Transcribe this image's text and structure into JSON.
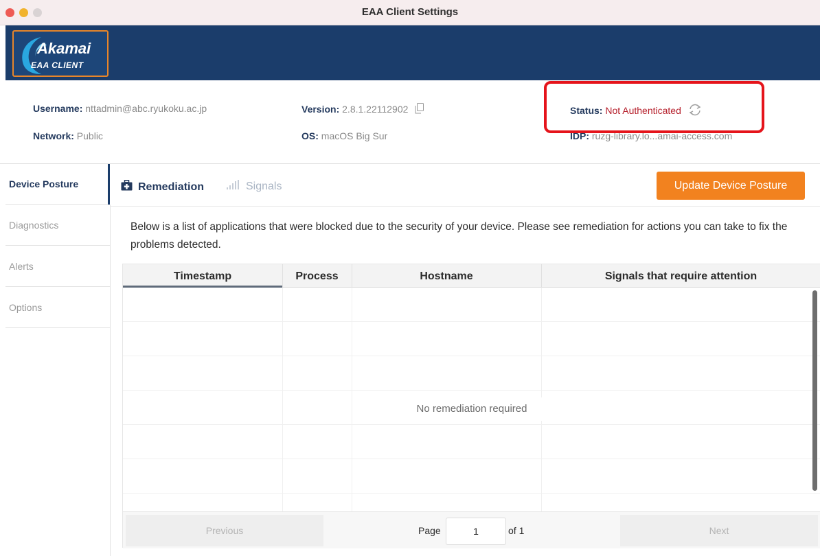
{
  "window": {
    "title": "EAA Client Settings"
  },
  "brand": {
    "name": "Akamai",
    "product": "EAA CLIENT"
  },
  "info": {
    "username_label": "Username:",
    "username_value": "nttadmin@abc.ryukoku.ac.jp",
    "network_label": "Network:",
    "network_value": "Public",
    "version_label": "Version:",
    "version_value": "2.8.1.22112902",
    "os_label": "OS:",
    "os_value": "macOS Big Sur",
    "status_label": "Status:",
    "status_value": "Not Authenticated",
    "idp_label": "IDP:",
    "idp_value": "ruzg-library.lo...amai-access.com"
  },
  "sidebar": {
    "items": [
      {
        "label": "Device Posture"
      },
      {
        "label": "Diagnostics"
      },
      {
        "label": "Alerts"
      },
      {
        "label": "Options"
      }
    ]
  },
  "tabs": {
    "remediation": "Remediation",
    "signals": "Signals",
    "update_button": "Update Device Posture"
  },
  "description": "Below is a list of applications that were blocked due to the security of your device. Please see remediation for actions you can take to fix the problems detected.",
  "table": {
    "columns": [
      "Timestamp",
      "Process",
      "Hostname",
      "Signals that require attention"
    ],
    "empty_message": "No remediation required"
  },
  "pagination": {
    "previous": "Previous",
    "page_label": "Page",
    "page_value": "1",
    "of_label": "of 1",
    "next": "Next"
  },
  "colors": {
    "brand_navy": "#1b3d6b",
    "accent_orange": "#f2821f",
    "status_red": "#b51e2a",
    "highlight_red": "#e5141b"
  }
}
